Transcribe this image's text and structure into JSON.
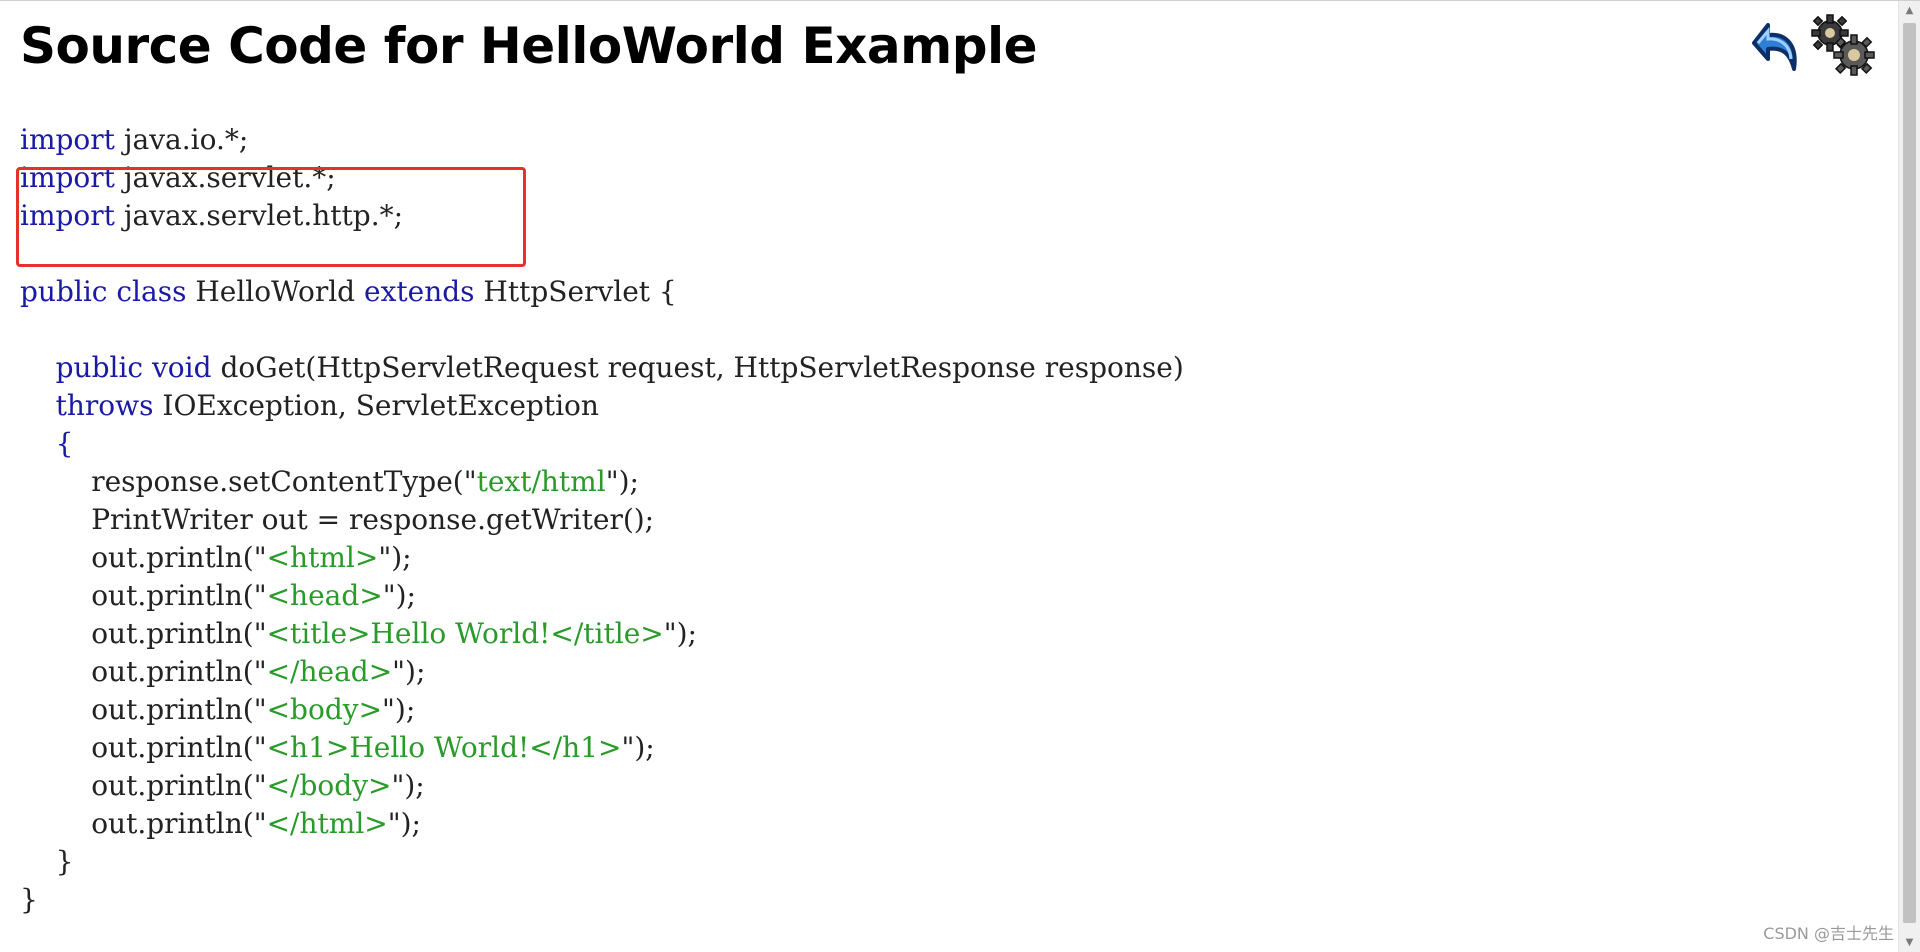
{
  "page": {
    "title": "Source Code for HelloWorld Example"
  },
  "icons": {
    "back": "back-arrow-icon",
    "gears": "gears-icon"
  },
  "code": {
    "lines": [
      [
        {
          "k": "kw",
          "t": "import"
        },
        {
          "k": "plain",
          "t": " java.io.*;"
        }
      ],
      [
        {
          "k": "kw",
          "t": "import"
        },
        {
          "k": "plain",
          "t": " javax.servlet.*;"
        }
      ],
      [
        {
          "k": "kw",
          "t": "import"
        },
        {
          "k": "plain",
          "t": " javax.servlet.http.*;"
        }
      ],
      [],
      [
        {
          "k": "kw",
          "t": "public class"
        },
        {
          "k": "plain",
          "t": " HelloWorld "
        },
        {
          "k": "kw",
          "t": "extends"
        },
        {
          "k": "plain",
          "t": " HttpServlet {"
        }
      ],
      [],
      [
        {
          "k": "plain",
          "t": "    "
        },
        {
          "k": "kw",
          "t": "public void"
        },
        {
          "k": "plain",
          "t": " doGet(HttpServletRequest request, HttpServletResponse response)"
        }
      ],
      [
        {
          "k": "plain",
          "t": "    "
        },
        {
          "k": "kw",
          "t": "throws"
        },
        {
          "k": "plain",
          "t": " IOException, ServletException"
        }
      ],
      [
        {
          "k": "plain",
          "t": "    "
        },
        {
          "k": "kw",
          "t": "{"
        }
      ],
      [
        {
          "k": "plain",
          "t": "        response.setContentType(\""
        },
        {
          "k": "str",
          "t": "text/html"
        },
        {
          "k": "plain",
          "t": "\");"
        }
      ],
      [
        {
          "k": "plain",
          "t": "        PrintWriter out = response.getWriter();"
        }
      ],
      [
        {
          "k": "plain",
          "t": "        out.println(\""
        },
        {
          "k": "str",
          "t": "<html>"
        },
        {
          "k": "plain",
          "t": "\");"
        }
      ],
      [
        {
          "k": "plain",
          "t": "        out.println(\""
        },
        {
          "k": "str",
          "t": "<head>"
        },
        {
          "k": "plain",
          "t": "\");"
        }
      ],
      [
        {
          "k": "plain",
          "t": "        out.println(\""
        },
        {
          "k": "str",
          "t": "<title>Hello World!</title>"
        },
        {
          "k": "plain",
          "t": "\");"
        }
      ],
      [
        {
          "k": "plain",
          "t": "        out.println(\""
        },
        {
          "k": "str",
          "t": "</head>"
        },
        {
          "k": "plain",
          "t": "\");"
        }
      ],
      [
        {
          "k": "plain",
          "t": "        out.println(\""
        },
        {
          "k": "str",
          "t": "<body>"
        },
        {
          "k": "plain",
          "t": "\");"
        }
      ],
      [
        {
          "k": "plain",
          "t": "        out.println(\""
        },
        {
          "k": "str",
          "t": "<h1>Hello World!</h1>"
        },
        {
          "k": "plain",
          "t": "\");"
        }
      ],
      [
        {
          "k": "plain",
          "t": "        out.println(\""
        },
        {
          "k": "str",
          "t": "</body>"
        },
        {
          "k": "plain",
          "t": "\");"
        }
      ],
      [
        {
          "k": "plain",
          "t": "        out.println(\""
        },
        {
          "k": "str",
          "t": "</html>"
        },
        {
          "k": "plain",
          "t": "\");"
        }
      ],
      [
        {
          "k": "plain",
          "t": "    }"
        }
      ],
      [
        {
          "k": "plain",
          "t": "}"
        }
      ]
    ]
  },
  "watermark": "CSDN @吉士先生",
  "colors": {
    "keyword": "#1a1aa6",
    "string": "#2a9a2a",
    "plain": "#222222",
    "highlight_box": "#e8302a"
  }
}
